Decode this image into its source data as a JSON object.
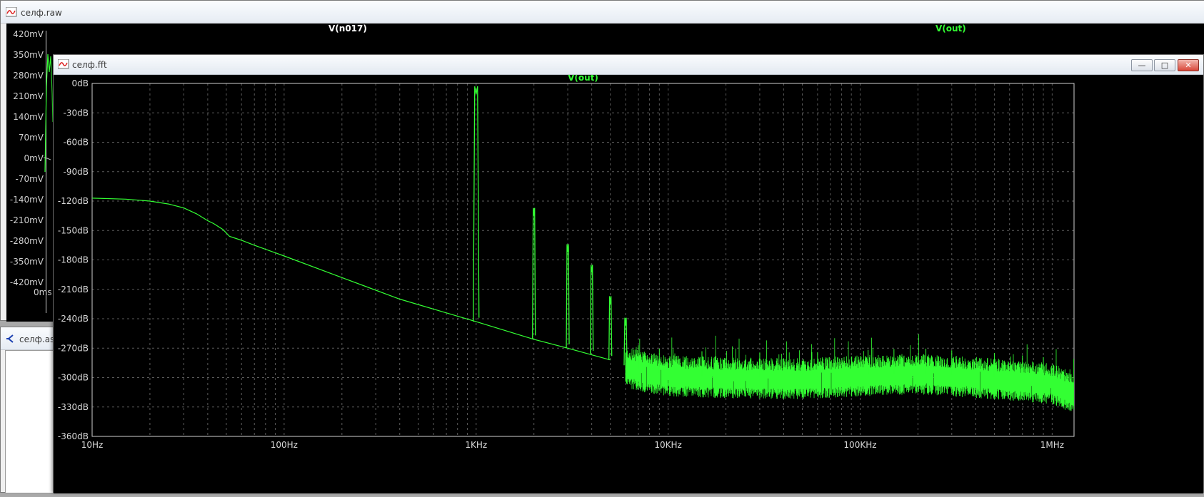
{
  "raw_window": {
    "title": "селф.raw",
    "trace_left": "V(n017)",
    "trace_right": "V(out)",
    "y_ticks": [
      "420mV",
      "350mV",
      "280mV",
      "210mV",
      "140mV",
      "70mV",
      "0mV",
      "-70mV",
      "-140mV",
      "-210mV",
      "-280mV",
      "-350mV",
      "-420mV"
    ],
    "x_first_tick": "0ms"
  },
  "asc_window": {
    "title": "селф.asc"
  },
  "fft_window": {
    "title": "селф.fft",
    "buttons": {
      "minimize": "—",
      "restore": "□",
      "close": "✕"
    }
  },
  "colors": {
    "background": "#000000",
    "trace": "#33ff33",
    "grid": "#5a5a5a",
    "axis_text": "#d8d8d8",
    "trace_title_left": "#ffffff",
    "trace_title_right": "#33ff33"
  },
  "chart_data": {
    "type": "line",
    "title": "V(out)",
    "xlabel": "",
    "ylabel": "",
    "x_scale": "log",
    "xlim": [
      10,
      1300000
    ],
    "ylim": [
      -360,
      0
    ],
    "grid": true,
    "x_ticks": [
      {
        "value": 10,
        "label": "10Hz"
      },
      {
        "value": 100,
        "label": "100Hz"
      },
      {
        "value": 1000,
        "label": "1KHz"
      },
      {
        "value": 10000,
        "label": "10KHz"
      },
      {
        "value": 100000,
        "label": "100KHz"
      },
      {
        "value": 1000000,
        "label": "1MHz"
      }
    ],
    "y_ticks": [
      {
        "value": 0,
        "label": "0dB"
      },
      {
        "value": -30,
        "label": "-30dB"
      },
      {
        "value": -60,
        "label": "-60dB"
      },
      {
        "value": -90,
        "label": "-90dB"
      },
      {
        "value": -120,
        "label": "-120dB"
      },
      {
        "value": -150,
        "label": "-150dB"
      },
      {
        "value": -180,
        "label": "-180dB"
      },
      {
        "value": -210,
        "label": "-210dB"
      },
      {
        "value": -240,
        "label": "-240dB"
      },
      {
        "value": -270,
        "label": "-270dB"
      },
      {
        "value": -300,
        "label": "-300dB"
      },
      {
        "value": -330,
        "label": "-330dB"
      },
      {
        "value": -360,
        "label": "-360dB"
      }
    ],
    "series": [
      {
        "name": "V(out)",
        "points": [
          [
            10,
            -117
          ],
          [
            15,
            -118
          ],
          [
            20,
            -120
          ],
          [
            25,
            -123
          ],
          [
            30,
            -127
          ],
          [
            35,
            -133
          ],
          [
            40,
            -140
          ],
          [
            43,
            -143
          ],
          [
            48,
            -149
          ],
          [
            52,
            -156
          ],
          [
            60,
            -160
          ],
          [
            70,
            -165
          ],
          [
            100,
            -176
          ],
          [
            200,
            -198
          ],
          [
            400,
            -220
          ],
          [
            700,
            -234
          ],
          [
            1000,
            -243
          ],
          [
            2000,
            -261
          ],
          [
            3000,
            -270
          ],
          [
            5000,
            -282
          ],
          [
            7000,
            -292
          ],
          [
            10000,
            -297
          ],
          [
            20000,
            -299
          ],
          [
            50000,
            -300
          ],
          [
            100000,
            -297
          ],
          [
            200000,
            -295
          ],
          [
            500000,
            -300
          ],
          [
            1000000,
            -305
          ],
          [
            1300000,
            -315
          ]
        ]
      }
    ],
    "harmonics": [
      {
        "freq": 1000,
        "peak_db": -11
      },
      {
        "freq": 2000,
        "peak_db": -135
      },
      {
        "freq": 3000,
        "peak_db": -172
      },
      {
        "freq": 4000,
        "peak_db": -193
      },
      {
        "freq": 5000,
        "peak_db": -225
      },
      {
        "freq": 6000,
        "peak_db": -247
      }
    ],
    "noise_floor": {
      "from_freq": 6000,
      "center_db": -298,
      "spread_db": 22
    }
  }
}
